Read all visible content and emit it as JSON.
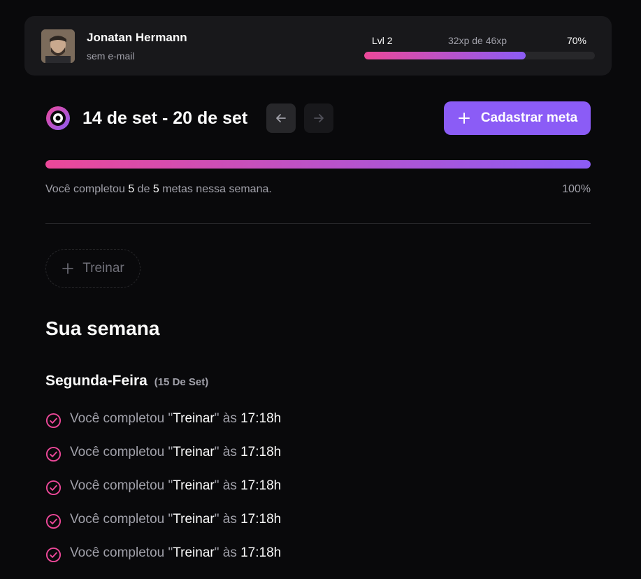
{
  "user": {
    "name": "Jonatan Hermann",
    "email": "sem e-mail",
    "level_label": "Lvl 2",
    "xp_label": "32xp de 46xp",
    "xp_percent_label": "70%",
    "xp_fraction": 0.7
  },
  "week": {
    "range": "14 de set - 20 de set",
    "add_goal_label": "Cadastrar meta",
    "progress_fraction": 1.0,
    "summary_prefix": "Você completou",
    "completed": "5",
    "summary_of": "de",
    "total": "5",
    "summary_suffix": "metas nessa semana.",
    "percent_label": "100%"
  },
  "pending_goals": [
    {
      "label": "Treinar"
    }
  ],
  "summary_section": {
    "title": "Sua semana",
    "day": {
      "name": "Segunda-Feira",
      "date": "(15 De Set)",
      "activities": [
        {
          "prefix": "Você completou",
          "goal": "Treinar",
          "at": "às",
          "time": "17:18h"
        },
        {
          "prefix": "Você completou",
          "goal": "Treinar",
          "at": "às",
          "time": "17:18h"
        },
        {
          "prefix": "Você completou",
          "goal": "Treinar",
          "at": "às",
          "time": "17:18h"
        },
        {
          "prefix": "Você completou",
          "goal": "Treinar",
          "at": "às",
          "time": "17:18h"
        },
        {
          "prefix": "Você completou",
          "goal": "Treinar",
          "at": "às",
          "time": "17:18h"
        }
      ]
    }
  },
  "colors": {
    "background": "#09090b",
    "card": "#18181b",
    "accent": "#8b5cf6",
    "accent_pink": "#ec4899"
  },
  "icons": [
    "avatar-photo",
    "app-logo-icon",
    "arrow-left-icon",
    "arrow-right-icon",
    "plus-icon",
    "check-circle-icon"
  ]
}
